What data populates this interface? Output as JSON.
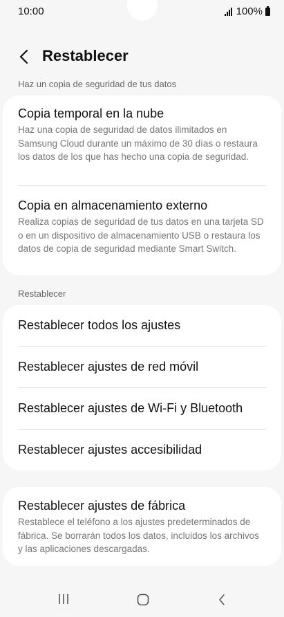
{
  "status": {
    "time": "10:00",
    "battery": "100%"
  },
  "header": {
    "title": "Restablecer"
  },
  "backup_section": {
    "label": "Haz un copia de seguridad de tus datos",
    "items": [
      {
        "title": "Copia temporal en la nube",
        "desc": "Haz una copia de seguridad de datos ilimitados en Samsung Cloud durante un máximo de 30 días o restaura los datos de los que has hecho una copia de seguridad."
      },
      {
        "title": "Copia en almacenamiento externo",
        "desc": "Realiza copias de seguridad de tus datos en una tarjeta SD o en un dispositivo de almacenamiento USB o restaura los datos de copia de seguridad mediante Smart Switch."
      }
    ]
  },
  "reset_section": {
    "label": "Restablecer",
    "items": [
      {
        "title": "Restablecer todos los ajustes"
      },
      {
        "title": "Restablecer ajustes de red móvil"
      },
      {
        "title": "Restablecer ajustes de Wi-Fi y Bluetooth"
      },
      {
        "title": "Restablecer ajustes accesibilidad"
      }
    ]
  },
  "factory": {
    "title": "Restablecer ajustes de fábrica",
    "desc": "Restablece el teléfono a los ajustes predeterminados de fábrica. Se borrarán todos los datos, incluidos los archivos y las aplicaciones descargadas."
  },
  "icons": {
    "back": "chevron-left-icon",
    "nav_recent": "recent-apps-icon",
    "nav_home": "home-icon",
    "nav_back": "back-icon"
  }
}
